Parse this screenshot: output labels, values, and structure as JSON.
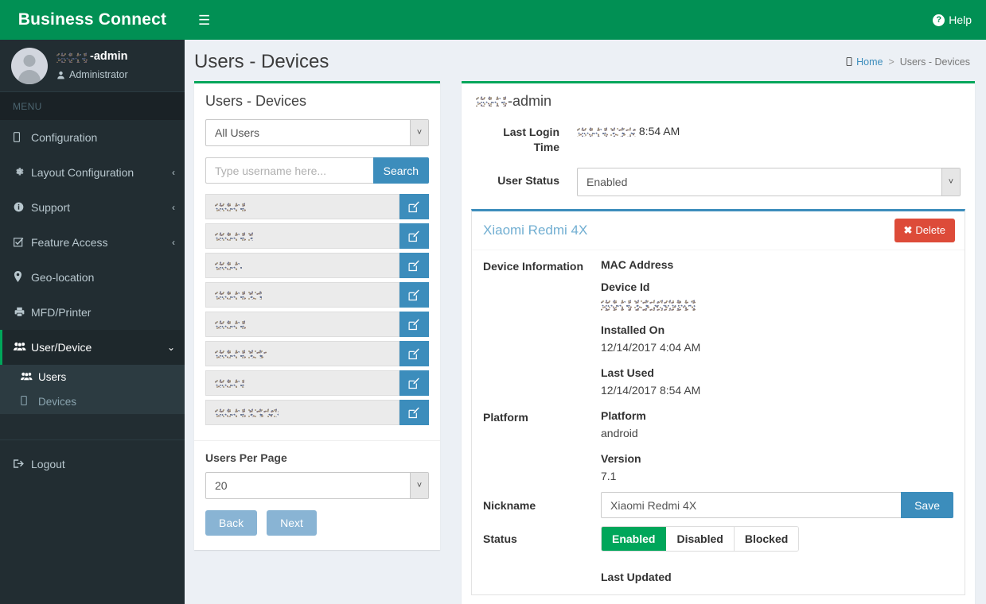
{
  "brand": {
    "title": "Business Connect"
  },
  "user_panel": {
    "name_suffix": "-admin",
    "role": "Administrator",
    "role_icon": "user-icon"
  },
  "sidebar": {
    "menu_header": "MENU",
    "items": [
      {
        "label": "Configuration",
        "icon": "mobile-icon",
        "caret": "",
        "active": false
      },
      {
        "label": "Layout Configuration",
        "icon": "gear-icon",
        "caret": "‹",
        "active": false
      },
      {
        "label": "Support",
        "icon": "info-icon",
        "caret": "‹",
        "active": false
      },
      {
        "label": "Feature Access",
        "icon": "check-square-icon",
        "caret": "‹",
        "active": false
      },
      {
        "label": "Geo-location",
        "icon": "map-marker-icon",
        "caret": "",
        "active": false
      },
      {
        "label": "MFD/Printer",
        "icon": "printer-icon",
        "caret": "",
        "active": false
      },
      {
        "label": "User/Device",
        "icon": "users-icon",
        "caret": "⌄",
        "active": true
      }
    ],
    "submenu": [
      {
        "label": "Users",
        "icon": "users-icon",
        "active": true
      },
      {
        "label": "Devices",
        "icon": "mobile-icon",
        "active": false
      }
    ],
    "logout": {
      "label": "Logout",
      "icon": "sign-out-icon"
    }
  },
  "topbar": {
    "menu_toggle_icon": "hamburger-icon",
    "help_label": "Help",
    "help_icon": "question-circle-icon"
  },
  "content_header": {
    "page_title": "Users - Devices",
    "breadcrumb": {
      "home_label": "Home",
      "home_icon": "mobile-icon",
      "separator": ">",
      "current": "Users - Devices"
    }
  },
  "left_panel": {
    "title": "Users - Devices",
    "user_filter": {
      "selected": "All Users",
      "arrow_icon": "chevron-down-icon"
    },
    "search": {
      "placeholder": "Type username here...",
      "value": "",
      "button_label": "Search"
    },
    "user_rows": [
      {
        "name": "",
        "edit_icon": "edit-pencil-icon"
      },
      {
        "name": "",
        "edit_icon": "edit-pencil-icon"
      },
      {
        "name": "",
        "edit_icon": "edit-pencil-icon"
      },
      {
        "name": "",
        "edit_icon": "edit-pencil-icon"
      },
      {
        "name": "",
        "edit_icon": "edit-pencil-icon"
      },
      {
        "name": "",
        "edit_icon": "edit-pencil-icon"
      },
      {
        "name": "",
        "edit_icon": "edit-pencil-icon"
      },
      {
        "name": "",
        "edit_icon": "edit-pencil-icon"
      }
    ],
    "users_per_page": {
      "label": "Users Per Page",
      "selected": "20",
      "arrow_icon": "chevron-down-icon"
    },
    "pagination": {
      "back_label": "Back",
      "next_label": "Next"
    }
  },
  "right_panel": {
    "user_title_suffix": "-admin",
    "last_login": {
      "label": "Last Login Time",
      "value": "8:54 AM"
    },
    "user_status": {
      "label": "User Status",
      "selected": "Enabled",
      "arrow_icon": "chevron-down-icon"
    },
    "device": {
      "name": "Xiaomi Redmi 4X",
      "delete_label": "Delete",
      "delete_icon": "times-icon",
      "section_device_info": "Device Information",
      "section_platform": "Platform",
      "fields": [
        {
          "label": "MAC Address",
          "value": ""
        },
        {
          "label": "Device Id",
          "value": ""
        },
        {
          "label": "Installed On",
          "value": "12/14/2017 4:04 AM"
        },
        {
          "label": "Last Used",
          "value": "12/14/2017 8:54 AM"
        }
      ],
      "platform_fields": [
        {
          "label": "Platform",
          "value": "android"
        },
        {
          "label": "Version",
          "value": "7.1"
        }
      ],
      "nickname": {
        "label": "Nickname",
        "value": "Xiaomi Redmi 4X",
        "save_label": "Save"
      },
      "status": {
        "label": "Status",
        "options": [
          "Enabled",
          "Disabled",
          "Blocked"
        ],
        "selected": "Enabled"
      },
      "last_updated_label": "Last Updated"
    }
  },
  "colors": {
    "brand_green": "#019054",
    "accent_green": "#00a65a",
    "sidebar_dark": "#222d32",
    "submenu_bg": "#2c3b41",
    "primary_blue": "#3c8dbc",
    "danger_red": "#dd4b39",
    "page_bg": "#ecf0f5"
  }
}
